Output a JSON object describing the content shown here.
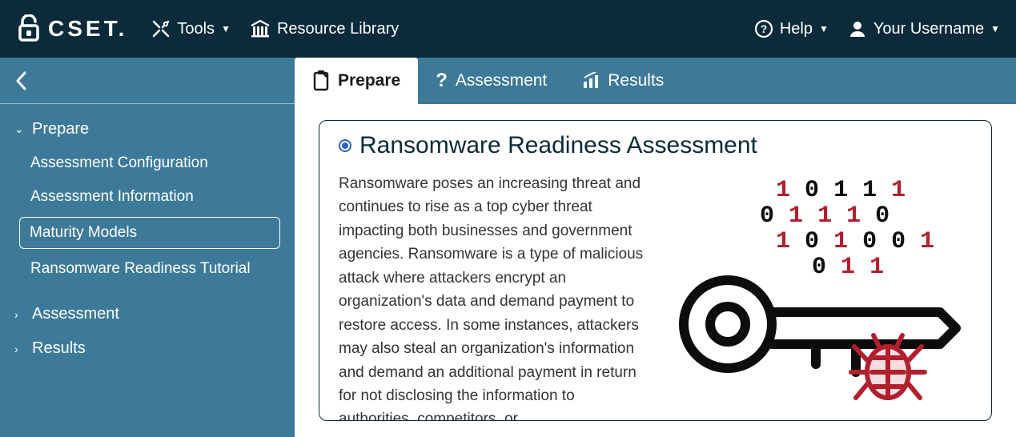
{
  "topbar": {
    "brand": "CSET",
    "tools_label": "Tools",
    "resource_library_label": "Resource Library",
    "help_label": "Help",
    "username_label": "Your Username"
  },
  "sidebar": {
    "groups": [
      {
        "label": "Prepare",
        "expanded": true,
        "items": [
          "Assessment Configuration",
          "Assessment Information",
          "Maturity Models",
          "Ransomware Readiness Tutorial"
        ],
        "active_index": 2
      },
      {
        "label": "Assessment",
        "expanded": false
      },
      {
        "label": "Results",
        "expanded": false
      }
    ]
  },
  "tabs": {
    "items": [
      {
        "label": "Prepare",
        "icon": "clipboard"
      },
      {
        "label": "Assessment",
        "icon": "question"
      },
      {
        "label": "Results",
        "icon": "chart"
      }
    ],
    "active_index": 0
  },
  "content": {
    "title": "Ransomware Readiness Assessment",
    "body": "Ransomware poses an increasing threat and continues to rise as a top cyber threat impacting both businesses and government agencies. Ransomware is a type of malicious attack where attackers encrypt an organization's data and demand payment to restore access. In some instances, attackers may also steal an organization's information and demand an additional payment in return for not disclosing the information to authorities, competitors, or"
  }
}
